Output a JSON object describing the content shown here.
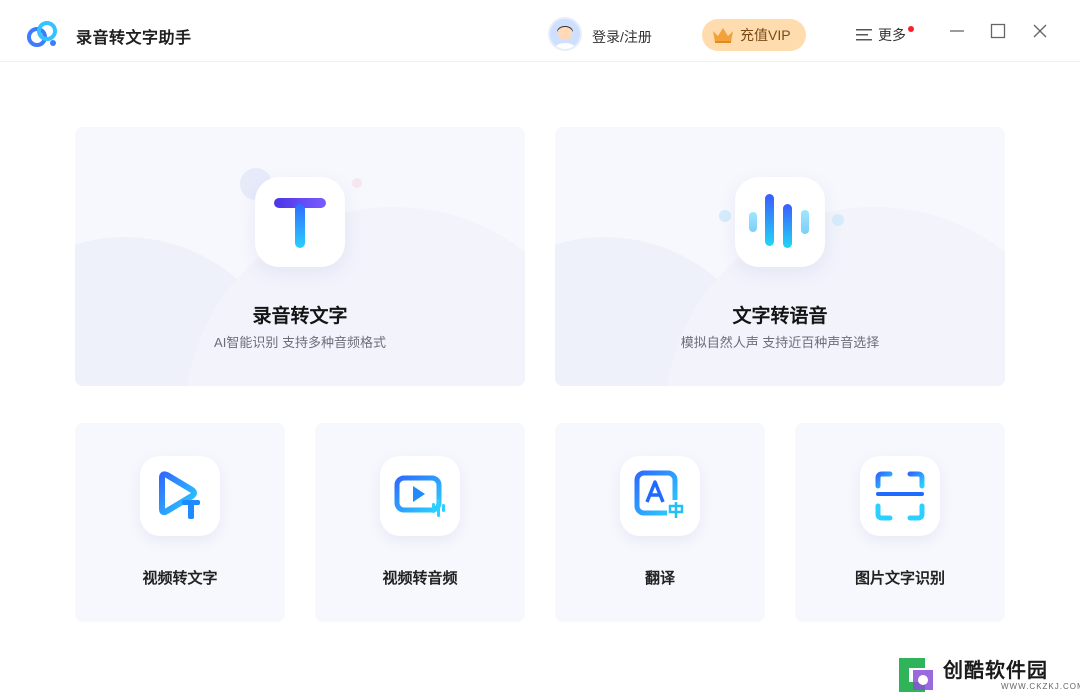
{
  "window": {
    "title": "录音转文字助手",
    "login_label": "登录/注册",
    "vip_label": "充值VIP",
    "more_label": "更多",
    "accent_color": "#3d7bff",
    "vip_color": "#ffdcae"
  },
  "features": {
    "primary": [
      {
        "title": "录音转文字",
        "subtitle": "AI智能识别 支持多种音频格式",
        "icon": "text-t-icon"
      },
      {
        "title": "文字转语音",
        "subtitle": "模拟自然人声 支持近百种声音选择",
        "icon": "sound-wave-icon"
      }
    ],
    "secondary": [
      {
        "title": "视频转文字",
        "icon": "video-play-text-icon"
      },
      {
        "title": "视频转音频",
        "icon": "video-play-audio-icon"
      },
      {
        "title": "翻译",
        "icon": "translate-icon"
      },
      {
        "title": "图片文字识别",
        "icon": "scan-frame-icon"
      }
    ]
  },
  "watermark": {
    "name": "创酷软件园",
    "url": "WWW.CKZKJ.COM"
  }
}
